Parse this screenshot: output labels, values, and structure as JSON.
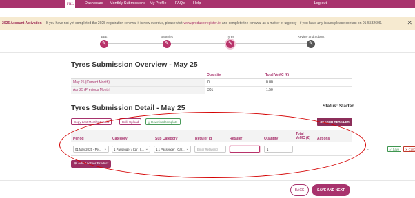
{
  "nav": {
    "logo": "PRL",
    "items": [
      "Dashboard",
      "Monthly Submissions",
      "My Profile",
      "FAQ's",
      "Help"
    ],
    "logout": "Log out"
  },
  "banner": {
    "title": "2025 Account Activation",
    "text_before": "– If you have not yet completed the 2025 registration renewal it is now overdue, please visit",
    "link": "www.producerregister.ie",
    "text_after": "and complete the renewal as a matter of urgency - if you have any issues please contact on 01-5532609.",
    "close": "✕"
  },
  "steps": [
    {
      "label": "EEE",
      "icon": "✎"
    },
    {
      "label": "Batteries",
      "icon": "✎"
    },
    {
      "label": "Tyres",
      "icon": "✎"
    },
    {
      "label": "Review and Submit",
      "icon": "✎"
    }
  ],
  "overview": {
    "title": "Tyres Submission Overview - May 25",
    "columns": [
      "",
      "Quantity",
      "Total VeMC (€)"
    ],
    "rows": [
      {
        "month": "May 25 (Current Month)",
        "quantity": "0",
        "total": "0.00"
      },
      {
        "month": "Apr 25 (Previous Month)",
        "quantity": "301",
        "total": "1.50"
      }
    ]
  },
  "detail": {
    "title": "Tyres Submission Detail - May 25",
    "status": "Status: Started",
    "buttons": {
      "copy": "Copy Last Months Details",
      "bulk": "Bulk Upload",
      "download": "Download template",
      "search": "SEARCH RETAILER"
    },
    "columns": {
      "period": "Period",
      "category": "Category",
      "sub_category": "Sub Category",
      "retailer_id": "Retailer Id",
      "retailer": "Retailer",
      "quantity": "Quantity",
      "total_vemc_1": "Total",
      "total_vemc_2": "VeMC (€)",
      "actions": "Actions"
    },
    "row": {
      "period": "01 May 2025 - Pe...",
      "category": "1 Passenger / Car / L...",
      "sub_category": "1.1 Passenger / Car...",
      "retailer_id_placeholder": "Enter Retailerid",
      "retailer": "",
      "quantity": "1",
      "total": "-",
      "save": "✓ Save",
      "cancel": "✕ Cancel"
    },
    "add_product": "Add Another Product"
  },
  "footer": {
    "back": "BACK",
    "save_next": "SAVE AND NEXT"
  },
  "colors": {
    "brand": "#a8336d",
    "banner_bg": "#f6ead0",
    "annotation": "#d40000"
  }
}
